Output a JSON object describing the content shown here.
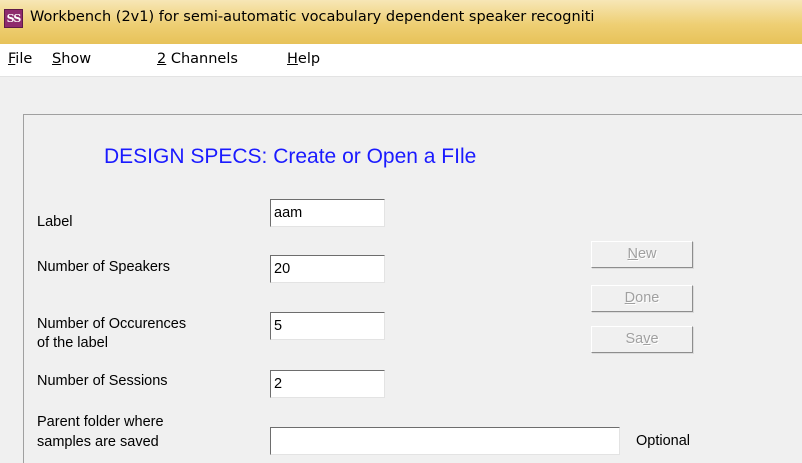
{
  "window": {
    "title": "Workbench (2v1) for semi-automatic vocabulary dependent speaker recogniti",
    "icon": "ss-app-icon",
    "icon_text": "S"
  },
  "menubar": {
    "items": [
      {
        "first": "F",
        "rest": "ile"
      },
      {
        "first": "S",
        "rest": "how"
      },
      {
        "first": "2",
        "rest": " Channels"
      },
      {
        "first": "H",
        "rest": "elp"
      }
    ]
  },
  "form": {
    "heading": "DESIGN SPECS: Create or Open a FIle",
    "label_label": "Label",
    "label_value": "aam",
    "speakers_label": "Number of Speakers",
    "speakers_value": "20",
    "occurences_label_line1": "Number of Occurences",
    "occurences_label_line2": "of the label",
    "occurences_value": "5",
    "sessions_label": "Number of Sessions",
    "sessions_value": "2",
    "folder_label_line1": "Parent folder where",
    "folder_label_line2": "samples are saved",
    "folder_value": "",
    "optional_text": "Optional"
  },
  "buttons": {
    "new": {
      "before": "",
      "acc": "N",
      "after": "ew"
    },
    "done": {
      "before": "",
      "acc": "D",
      "after": "one"
    },
    "save": {
      "before": "Sa",
      "acc": "v",
      "after": "e"
    }
  },
  "colors": {
    "heading": "#1a1aff",
    "disabled_text": "#a0a0a0",
    "titlebar": "#eecf74",
    "icon_bg": "#8e2a6d"
  }
}
